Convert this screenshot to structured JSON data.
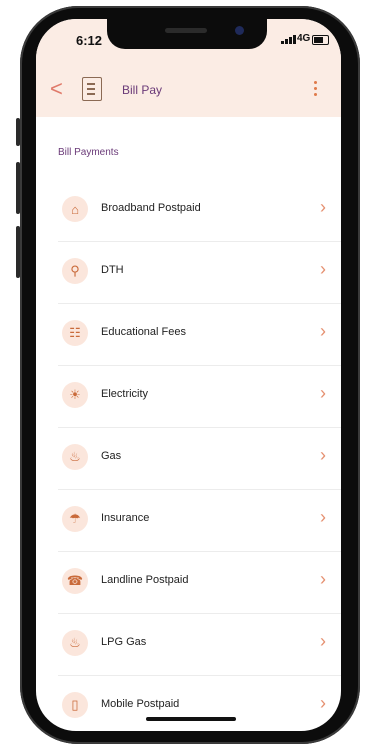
{
  "status_bar": {
    "time": "6:12",
    "network": "4G"
  },
  "header": {
    "title": "Bill Pay",
    "back_icon": "chevron-left-icon",
    "menu_icon": "more-vertical-icon",
    "accent": "#e07a4a",
    "background": "#fbece4"
  },
  "section_title": "Bill Payments",
  "items": [
    {
      "label": "Broadband Postpaid",
      "icon": "router-icon",
      "glyph": "⌂"
    },
    {
      "label": "DTH",
      "icon": "satellite-dish-icon",
      "glyph": "⚲"
    },
    {
      "label": "Educational Fees",
      "icon": "book-icon",
      "glyph": "☷"
    },
    {
      "label": "Electricity",
      "icon": "lightbulb-icon",
      "glyph": "☀"
    },
    {
      "label": "Gas",
      "icon": "flame-icon",
      "glyph": "♨"
    },
    {
      "label": "Insurance",
      "icon": "umbrella-icon",
      "glyph": "☂"
    },
    {
      "label": "Landline Postpaid",
      "icon": "telephone-icon",
      "glyph": "☎"
    },
    {
      "label": "LPG Gas",
      "icon": "flame-icon",
      "glyph": "♨"
    },
    {
      "label": "Mobile Postpaid",
      "icon": "mobile-icon",
      "glyph": "▯"
    }
  ],
  "row_chevron": "›"
}
